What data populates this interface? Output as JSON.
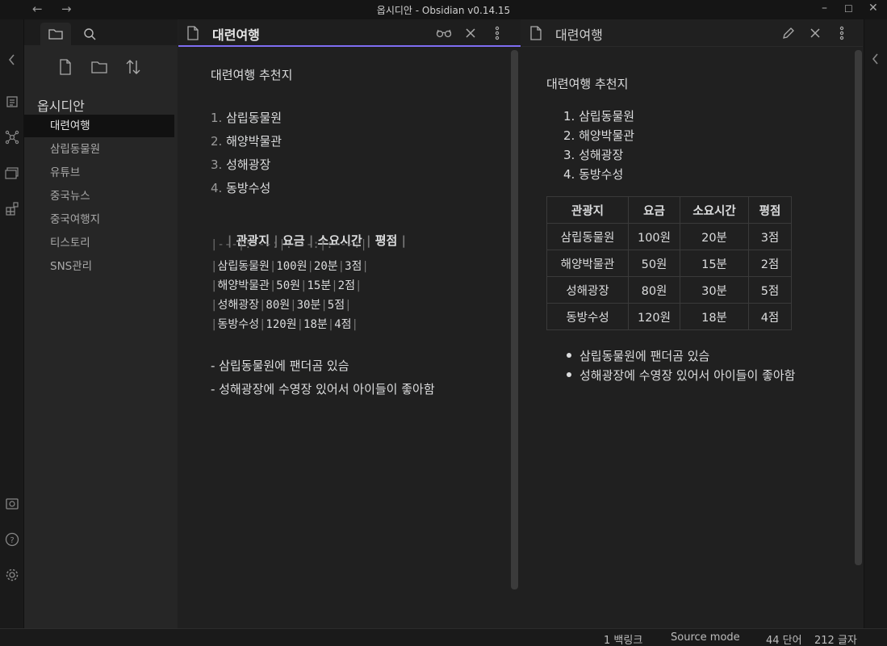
{
  "window": {
    "title": "옵시디안 - Obsidian v0.14.15"
  },
  "sidebar": {
    "vault_name": "옵시디안",
    "files": [
      "대련여행",
      "삼립동물원",
      "유튜브",
      "중국뉴스",
      "중국여행지",
      "티스토리",
      "SNS관리"
    ],
    "active_file": "대련여행"
  },
  "editor": {
    "title": "대련여행",
    "heading": "대련여행 추천지",
    "list": [
      {
        "num": "1.",
        "text": "삼립동물원"
      },
      {
        "num": "2.",
        "text": "해양박물관"
      },
      {
        "num": "3.",
        "text": "성해광장"
      },
      {
        "num": "4.",
        "text": "동방수성"
      }
    ],
    "table_source": {
      "header": [
        "관광지",
        "요금",
        "소요시간",
        "평점"
      ],
      "separator": "|---|:---:|:---:|:---:|",
      "rows": [
        [
          "삼립동물원",
          "100원",
          "20분",
          "3점"
        ],
        [
          "해양박물관",
          "50원",
          "15분",
          "2점"
        ],
        [
          "성해광장",
          "80원",
          "30분",
          "5점"
        ],
        [
          "동방수성",
          "120원",
          "18분",
          "4점"
        ]
      ]
    },
    "bullets": [
      "- 삼립동물원에 팬더곰 있슴",
      "- 성해광장에 수영장 있어서 아이들이 좋아함"
    ]
  },
  "preview": {
    "title": "대련여행",
    "heading": "대련여행 추천지",
    "list": [
      "1. 삼립동물원",
      "2. 해양박물관",
      "3. 성해광장",
      "4. 동방수성"
    ],
    "table": {
      "headers": [
        "관광지",
        "요금",
        "소요시간",
        "평점"
      ],
      "rows": [
        [
          "삼립동물원",
          "100원",
          "20분",
          "3점"
        ],
        [
          "해양박물관",
          "50원",
          "15분",
          "2점"
        ],
        [
          "성해광장",
          "80원",
          "30분",
          "5점"
        ],
        [
          "동방수성",
          "120원",
          "18분",
          "4점"
        ]
      ]
    },
    "bullets": [
      "삼립동물원에 팬더곰 있슴",
      "성해광장에 수영장 있어서 아이들이 좋아함"
    ]
  },
  "status": {
    "backlinks": "1 백링크",
    "mode": "Source mode",
    "words": "44 단어",
    "chars": "212 글자"
  },
  "colors": {
    "accent": "#7f6df2",
    "background": "#202020",
    "sidebar": "#262626"
  },
  "icons": {
    "nav": [
      "arrow-left-icon",
      "arrow-right-icon"
    ],
    "ribbon": [
      "collapse-left-icon",
      "quick-switcher-icon",
      "graph-icon",
      "templates-icon",
      "command-palette-icon",
      "open-vault-icon",
      "help-icon",
      "settings-icon"
    ],
    "sidebar_tabs": [
      "file-explorer-icon",
      "search-icon"
    ],
    "file_actions": [
      "new-note-icon",
      "new-folder-icon",
      "sort-icon"
    ],
    "editor_actions": [
      "reading-view-icon",
      "close-icon",
      "more-options-icon"
    ],
    "preview_actions": [
      "edit-icon",
      "close-icon",
      "more-options-icon"
    ]
  }
}
